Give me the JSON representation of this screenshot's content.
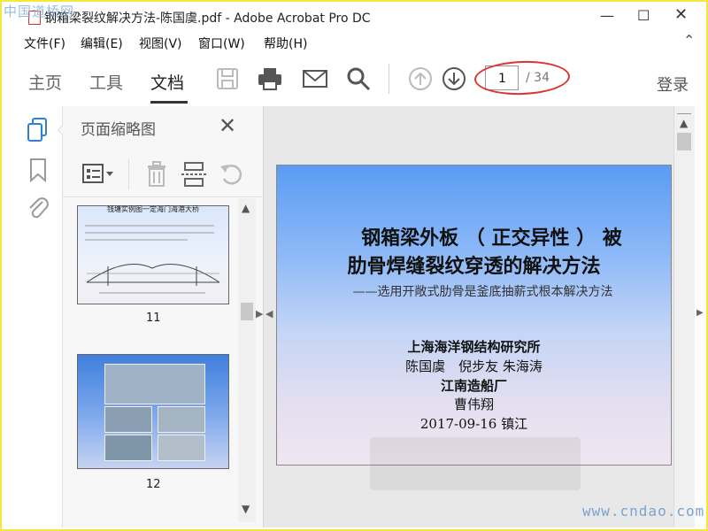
{
  "window": {
    "title": "钢箱梁裂纹解决方法-陈国虞.pdf - Adobe Acrobat Pro DC",
    "watermark_top": "中国道桥网",
    "watermark_bottom": "www.cndao.com"
  },
  "menu": [
    "文件(F)",
    "编辑(E)",
    "视图(V)",
    "窗口(W)",
    "帮助(H)"
  ],
  "tabs": [
    "主页",
    "工具",
    "文档"
  ],
  "active_tab": "文档",
  "toolbar": {
    "page_current": "1",
    "page_total": "/ 34",
    "login": "登录"
  },
  "left_panel": {
    "title": "页面缩略图",
    "thumbnails": [
      {
        "label": "11",
        "top_text": "钱塘实例图一定海门海港大桥"
      },
      {
        "label": "12"
      }
    ]
  },
  "slide": {
    "title_line1": "钢箱梁外板 （ 正交异性 ） 被",
    "title_line2": "肋骨焊缝裂纹穿透的解决方法",
    "subtitle": "——选用开敞式肋骨是釜底抽薪式根本解决方法",
    "org1": "上海海洋钢结构研究所",
    "authors1": "陈国虞　倪步友 朱海涛",
    "org2": "江南造船厂",
    "authors2": "曹伟翔",
    "date": "2017-09-16 镇江"
  },
  "colors": {
    "accent_red": "#dd3333",
    "frame_yellow": "#f4e93a",
    "icon_blue": "#2f7fd6"
  }
}
